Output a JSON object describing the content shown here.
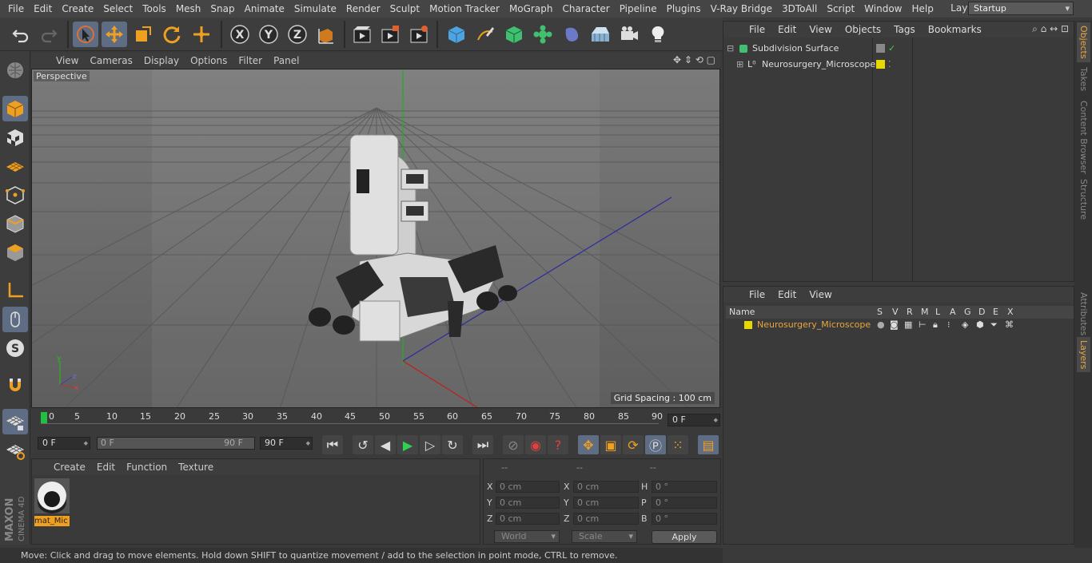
{
  "menubar": {
    "items": [
      "File",
      "Edit",
      "Create",
      "Select",
      "Tools",
      "Mesh",
      "Snap",
      "Animate",
      "Simulate",
      "Render",
      "Sculpt",
      "Motion Tracker",
      "MoGraph",
      "Character",
      "Pipeline",
      "Plugins",
      "V-Ray Bridge",
      "3DToAll",
      "Script",
      "Window",
      "Help"
    ],
    "layout_label": "Layout:",
    "layout_value": "Startup"
  },
  "viewport": {
    "menu": [
      "View",
      "Cameras",
      "Display",
      "Options",
      "Filter",
      "Panel"
    ],
    "camera_label": "Perspective",
    "grid_spacing": "Grid Spacing : 100 cm"
  },
  "timeline": {
    "ticks": [
      "0",
      "5",
      "10",
      "15",
      "20",
      "25",
      "30",
      "35",
      "40",
      "45",
      "50",
      "55",
      "60",
      "65",
      "70",
      "75",
      "80",
      "85",
      "90"
    ],
    "current_frame": "0 F",
    "start_frame": "0 F",
    "range_start": "0 F",
    "range_end": "90 F",
    "end_frame": "90 F"
  },
  "material_panel": {
    "menu": [
      "Create",
      "Edit",
      "Function",
      "Texture"
    ],
    "material_name": "mat_Mic"
  },
  "coord_panel": {
    "headers": [
      "--",
      "--",
      "--"
    ],
    "pos": {
      "x": "0 cm",
      "y": "0 cm",
      "z": "0 cm"
    },
    "size": {
      "x": "0 cm",
      "y": "0 cm",
      "z": "0 cm"
    },
    "rot": {
      "h": "0 °",
      "p": "0 °",
      "b": "0 °"
    },
    "labels": {
      "x": "X",
      "y": "Y",
      "z": "Z",
      "h": "H",
      "p": "P",
      "b": "B"
    },
    "mode1": "World",
    "mode2": "Scale",
    "apply": "Apply"
  },
  "status": "Move: Click and drag to move elements. Hold down SHIFT to quantize movement / add to the selection in point mode, CTRL to remove.",
  "objects_panel": {
    "menu": [
      "File",
      "Edit",
      "View",
      "Objects",
      "Tags",
      "Bookmarks"
    ],
    "items": [
      {
        "name": "Subdivision Surface"
      },
      {
        "name": "Neurosurgery_Microscope"
      }
    ]
  },
  "layers_panel": {
    "menu": [
      "File",
      "Edit",
      "View"
    ],
    "columns": [
      "Name",
      "S",
      "V",
      "R",
      "M",
      "L",
      "A",
      "G",
      "D",
      "E",
      "X"
    ],
    "layer_name": "Neurosurgery_Microscope",
    "layer_color": "#e8d800"
  },
  "side_tabs": [
    "Objects",
    "Takes",
    "Content Browser",
    "Structure",
    "Attributes",
    "Layers"
  ],
  "brand": {
    "line1": "MAXON",
    "line2": "CINEMA 4D"
  },
  "colors": {
    "accent": "#e8a640",
    "selected_tool": "#5e6c84",
    "layer_yellow": "#e8d800"
  }
}
